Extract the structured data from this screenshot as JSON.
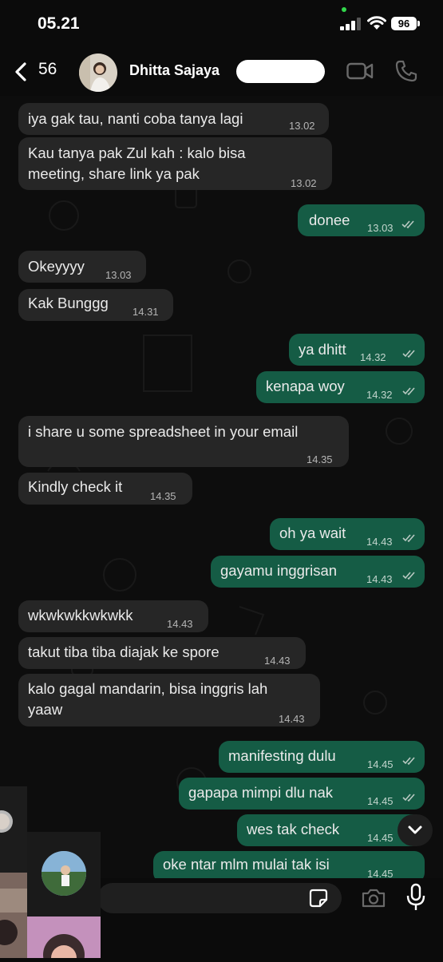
{
  "status": {
    "time": "05.21",
    "battery": "96"
  },
  "header": {
    "back_count": "56",
    "contact_name": "Dhitta Sajaya"
  },
  "messages": [
    {
      "dir": "in",
      "text": "iya gak tau, nanti coba tanya lagi",
      "time": "13.02"
    },
    {
      "dir": "in",
      "text": "Kau tanya pak Zul kah : kalo bisa meeting, share link ya pak",
      "time": "13.02"
    },
    {
      "dir": "out",
      "text": "donee",
      "time": "13.03"
    },
    {
      "dir": "in",
      "text": "Okeyyyy",
      "time": "13.03"
    },
    {
      "dir": "in",
      "text": "Kak Bunggg",
      "time": "14.31"
    },
    {
      "dir": "out",
      "text": "ya dhitt",
      "time": "14.32"
    },
    {
      "dir": "out",
      "text": "kenapa woy",
      "time": "14.32"
    },
    {
      "dir": "in",
      "text": "i share u some spreadsheet in your email",
      "time": "14.35"
    },
    {
      "dir": "in",
      "text": "Kindly check it",
      "time": "14.35"
    },
    {
      "dir": "out",
      "text": "oh ya wait",
      "time": "14.43"
    },
    {
      "dir": "out",
      "text": "gayamu inggrisan",
      "time": "14.43"
    },
    {
      "dir": "in",
      "text": "wkwkwkkwkwkk",
      "time": "14.43"
    },
    {
      "dir": "in",
      "text": "takut tiba tiba diajak ke spore",
      "time": "14.43"
    },
    {
      "dir": "in",
      "text": "kalo gagal mandarin, bisa inggris lah yaaw",
      "time": "14.43"
    },
    {
      "dir": "out",
      "text": "manifesting dulu",
      "time": "14.45"
    },
    {
      "dir": "out",
      "text": "gapapa mimpi dlu nak",
      "time": "14.45"
    },
    {
      "dir": "out",
      "text": "wes tak check",
      "time": "14.45"
    },
    {
      "dir": "out",
      "text": "oke ntar mlm mulai tak isi",
      "time": "14.45"
    }
  ],
  "icons": {
    "back": "chevron-left-icon",
    "video": "video-camera-icon",
    "call": "phone-icon",
    "scroll": "chevron-down-icon",
    "sticker": "sticker-icon",
    "camera": "camera-icon",
    "mic": "microphone-icon"
  },
  "colors": {
    "incoming_bubble": "#262626",
    "outgoing_bubble": "#155c45",
    "read_ticks": "#b9c9c2"
  }
}
